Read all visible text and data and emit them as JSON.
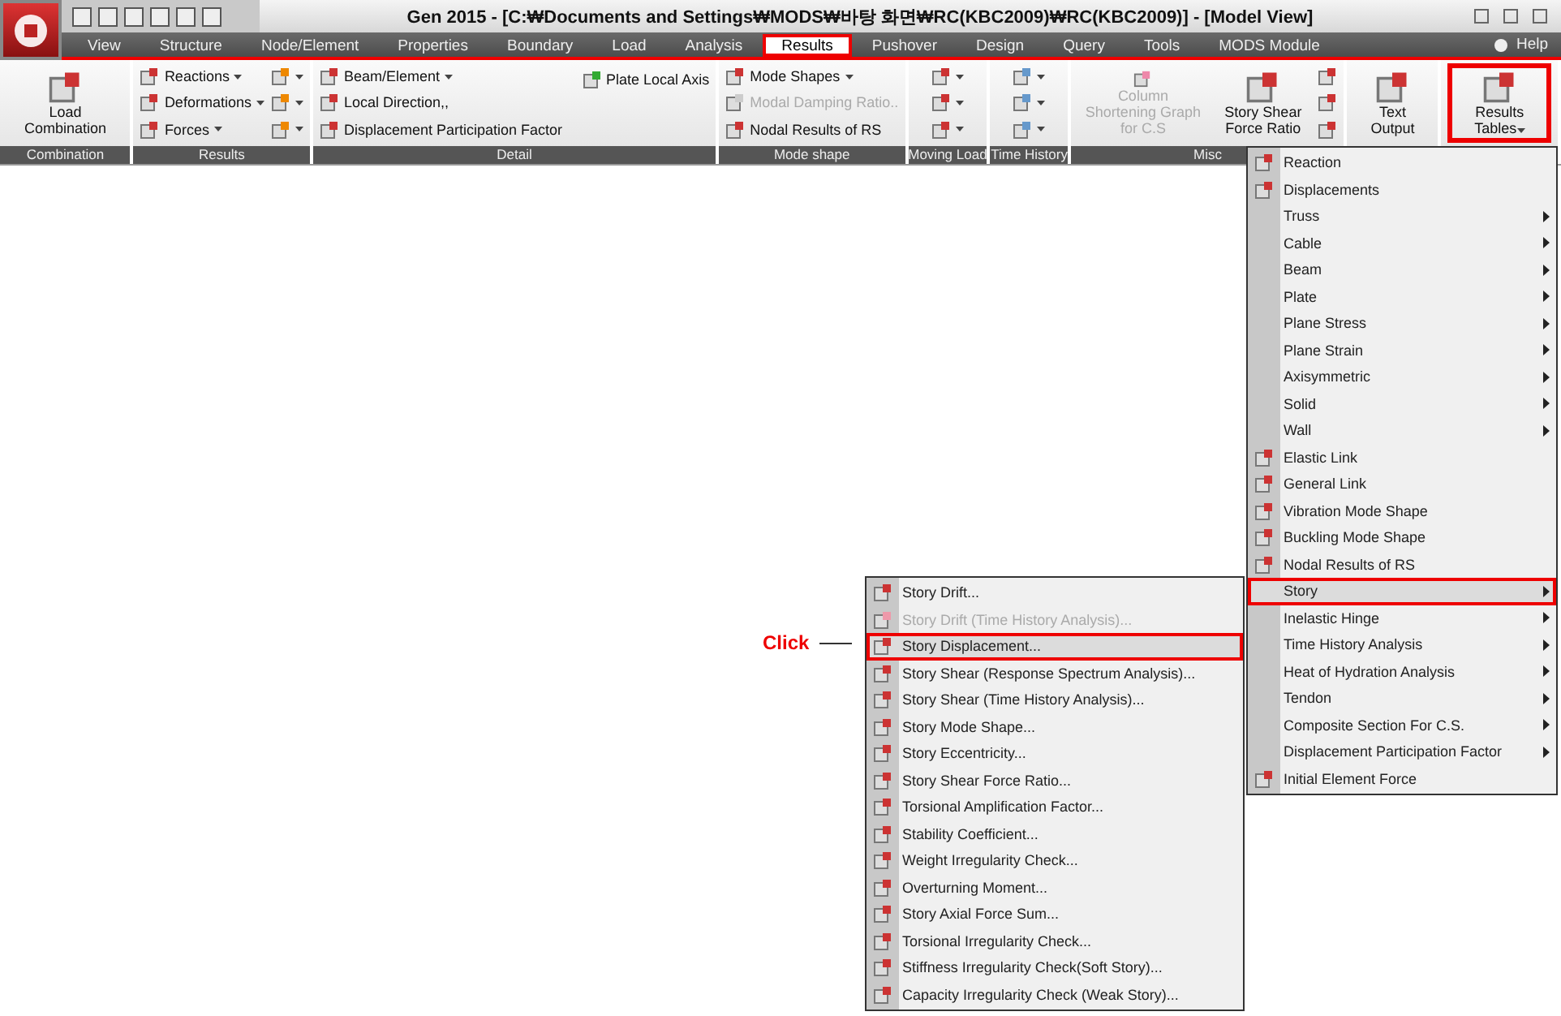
{
  "window": {
    "title": "Gen 2015 - [C:₩Documents and Settings₩MODS₩바탕 화면₩RC(KBC2009)₩RC(KBC2009)] - [Model View]"
  },
  "menu_tabs": [
    {
      "label": "View",
      "selected": false
    },
    {
      "label": "Structure",
      "selected": false
    },
    {
      "label": "Node/Element",
      "selected": false
    },
    {
      "label": "Properties",
      "selected": false
    },
    {
      "label": "Boundary",
      "selected": false
    },
    {
      "label": "Load",
      "selected": false
    },
    {
      "label": "Analysis",
      "selected": false
    },
    {
      "label": "Results",
      "selected": true
    },
    {
      "label": "Pushover",
      "selected": false
    },
    {
      "label": "Design",
      "selected": false
    },
    {
      "label": "Query",
      "selected": false
    },
    {
      "label": "Tools",
      "selected": false
    },
    {
      "label": "MODS Module",
      "selected": false
    }
  ],
  "help": {
    "label": "Help"
  },
  "ribbon": [
    {
      "kind": "large",
      "label": "Combination",
      "buttons": [
        {
          "label": "Load Combination",
          "disabled": false,
          "dropdown": false,
          "selected": false
        }
      ]
    },
    {
      "kind": "list",
      "label": "Results",
      "items": [
        {
          "label": "Reactions",
          "disabled": false,
          "dropdown": true
        },
        {
          "label": "Deformations",
          "disabled": false,
          "dropdown": true
        },
        {
          "label": "Forces",
          "disabled": false,
          "dropdown": true
        }
      ]
    },
    {
      "kind": "detail",
      "label": "Detail",
      "items": [
        {
          "label": "Beam/Element",
          "disabled": false,
          "dropdown": true
        },
        {
          "label": "Local Direction,,",
          "disabled": false,
          "dropdown": false
        },
        {
          "label": "Displacement Participation Factor",
          "disabled": false,
          "dropdown": false
        }
      ],
      "side_item": {
        "label": "Plate Local Axis"
      }
    },
    {
      "kind": "list",
      "label": "Mode shape",
      "items": [
        {
          "label": "Mode Shapes",
          "disabled": false,
          "dropdown": true
        },
        {
          "label": "Modal Damping Ratio..",
          "disabled": true,
          "dropdown": false
        },
        {
          "label": "Nodal Results of RS",
          "disabled": false,
          "dropdown": false
        }
      ]
    },
    {
      "kind": "icons",
      "label": "Moving Load"
    },
    {
      "kind": "icons",
      "label": "Time History"
    },
    {
      "kind": "large",
      "label": "Misc",
      "buttons": [
        {
          "label": "Column Shortening Graph for C.S",
          "disabled": true,
          "dropdown": false,
          "selected": false
        },
        {
          "label": "Story Shear Force Ratio",
          "disabled": false,
          "dropdown": false,
          "selected": false
        }
      ]
    },
    {
      "kind": "large",
      "buttons": [
        {
          "label": "Text Output",
          "disabled": false,
          "dropdown": false,
          "selected": false
        }
      ]
    },
    {
      "kind": "large",
      "buttons": [
        {
          "label": "Results Tables",
          "disabled": false,
          "dropdown": true,
          "selected": true
        }
      ]
    }
  ],
  "results_menu": [
    {
      "label": "Reaction",
      "icon": true,
      "submenu": false,
      "selected": false
    },
    {
      "label": "Displacements",
      "icon": true,
      "submenu": false,
      "selected": false
    },
    {
      "label": "Truss",
      "icon": false,
      "submenu": true,
      "selected": false
    },
    {
      "label": "Cable",
      "icon": false,
      "submenu": true,
      "selected": false
    },
    {
      "label": "Beam",
      "icon": false,
      "submenu": true,
      "selected": false
    },
    {
      "label": "Plate",
      "icon": false,
      "submenu": true,
      "selected": false
    },
    {
      "label": "Plane Stress",
      "icon": false,
      "submenu": true,
      "selected": false
    },
    {
      "label": "Plane Strain",
      "icon": false,
      "submenu": true,
      "selected": false
    },
    {
      "label": "Axisymmetric",
      "icon": false,
      "submenu": true,
      "selected": false
    },
    {
      "label": "Solid",
      "icon": false,
      "submenu": true,
      "selected": false
    },
    {
      "label": "Wall",
      "icon": false,
      "submenu": true,
      "selected": false
    },
    {
      "label": "Elastic Link",
      "icon": true,
      "submenu": false,
      "selected": false
    },
    {
      "label": "General Link",
      "icon": true,
      "submenu": false,
      "selected": false
    },
    {
      "label": "Vibration Mode Shape",
      "icon": true,
      "submenu": false,
      "selected": false
    },
    {
      "label": "Buckling Mode Shape",
      "icon": true,
      "submenu": false,
      "selected": false
    },
    {
      "label": "Nodal Results of RS",
      "icon": true,
      "submenu": false,
      "selected": false
    },
    {
      "label": "Story",
      "icon": false,
      "submenu": true,
      "selected": true
    },
    {
      "label": "Inelastic Hinge",
      "icon": false,
      "submenu": true,
      "selected": false
    },
    {
      "label": "Time History Analysis",
      "icon": false,
      "submenu": true,
      "selected": false
    },
    {
      "label": "Heat of Hydration Analysis",
      "icon": false,
      "submenu": true,
      "selected": false
    },
    {
      "label": "Tendon",
      "icon": false,
      "submenu": true,
      "selected": false
    },
    {
      "label": "Composite Section For C.S.",
      "icon": false,
      "submenu": true,
      "selected": false
    },
    {
      "label": "Displacement Participation Factor",
      "icon": false,
      "submenu": true,
      "selected": false
    },
    {
      "label": "Initial Element Force",
      "icon": true,
      "submenu": false,
      "selected": false
    }
  ],
  "story_menu": [
    {
      "label": "Story Drift...",
      "disabled": false,
      "selected": false
    },
    {
      "label": "Story Drift (Time History Analysis)...",
      "disabled": true,
      "selected": false
    },
    {
      "label": "Story Displacement...",
      "disabled": false,
      "selected": true
    },
    {
      "label": "Story Shear (Response Spectrum Analysis)...",
      "disabled": false,
      "selected": false
    },
    {
      "label": "Story Shear (Time History Analysis)...",
      "disabled": false,
      "selected": false
    },
    {
      "label": "Story Mode Shape...",
      "disabled": false,
      "selected": false
    },
    {
      "label": "Story Eccentricity...",
      "disabled": false,
      "selected": false
    },
    {
      "label": "Story Shear Force Ratio...",
      "disabled": false,
      "selected": false
    },
    {
      "label": "Torsional Amplification Factor...",
      "disabled": false,
      "selected": false
    },
    {
      "label": "Stability Coefficient...",
      "disabled": false,
      "selected": false
    },
    {
      "label": "Weight Irregularity Check...",
      "disabled": false,
      "selected": false
    },
    {
      "label": "Overturning Moment...",
      "disabled": false,
      "selected": false
    },
    {
      "label": "Story Axial Force Sum...",
      "disabled": false,
      "selected": false
    },
    {
      "label": "Torsional Irregularity Check...",
      "disabled": false,
      "selected": false
    },
    {
      "label": "Stiffness Irregularity Check(Soft Story)...",
      "disabled": false,
      "selected": false
    },
    {
      "label": "Capacity Irregularity Check (Weak Story)...",
      "disabled": false,
      "selected": false
    }
  ],
  "annotation": {
    "label": "Click"
  }
}
